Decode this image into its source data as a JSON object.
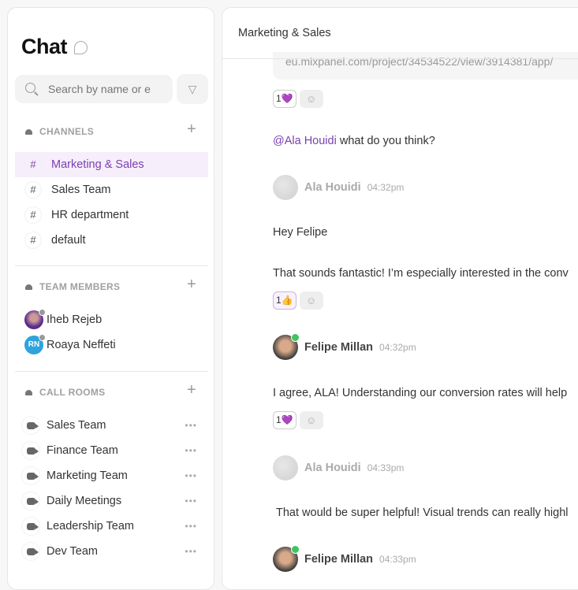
{
  "sidebar": {
    "title": "Chat",
    "search_placeholder": "Search by name or e",
    "channels": {
      "label": "CHANNELS",
      "items": [
        "Marketing & Sales",
        "Sales Team",
        "HR department",
        "default"
      ],
      "active": "Marketing & Sales"
    },
    "team_members": {
      "label": "TEAM MEMBERS",
      "items": [
        {
          "name": "Iheb Rejeb",
          "avatar": "photo"
        },
        {
          "name": "Roaya Neffeti",
          "initials": "RN",
          "color": "#2ea3dd"
        }
      ]
    },
    "call_rooms": {
      "label": "CALL ROOMS",
      "items": [
        "Sales Team",
        "Finance Team",
        "Marketing Team",
        "Daily Meetings",
        "Leadership Team",
        "Dev Team"
      ]
    }
  },
  "main": {
    "header": "Marketing & Sales",
    "link": "eu.mixpanel.com/project/34534522/view/3914381/app/",
    "reactions": [
      {
        "count": "1",
        "emoji": "💜"
      },
      {
        "count": "1",
        "emoji": "👍"
      },
      {
        "count": "1",
        "emoji": "💜"
      }
    ],
    "mention": "@Ala Houidi",
    "mention_rest": " what do you think?",
    "authors": [
      {
        "name": "Ala Houidi",
        "time": "04:32pm"
      },
      {
        "name": "Felipe Millan",
        "time": "04:32pm"
      },
      {
        "name": "Ala Houidi",
        "time": "04:33pm"
      },
      {
        "name": "Felipe Millan",
        "time": "04:33pm"
      }
    ],
    "messages": [
      "Hey Felipe",
      "That sounds fantastic! I’m especially interested in the conv",
      "I agree, ALA! Understanding our conversion rates will help",
      "That would be super helpful! Visual trends can really highl"
    ],
    "accent": "#7b3fb0"
  }
}
